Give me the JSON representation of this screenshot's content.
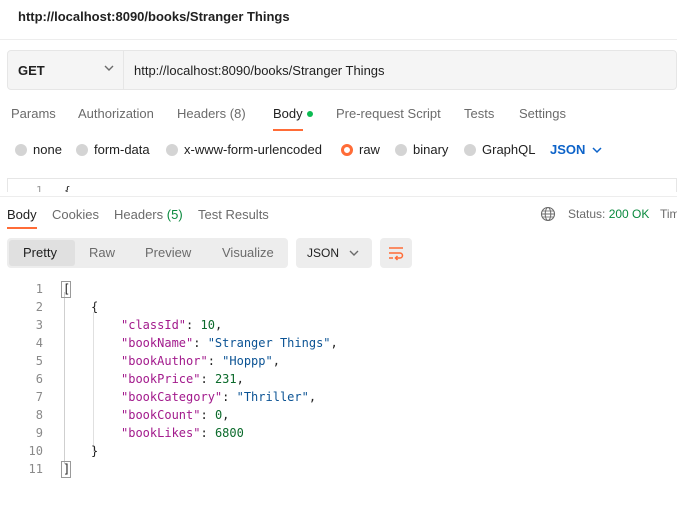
{
  "window": {
    "title": "http://localhost:8090/books/Stranger Things"
  },
  "request": {
    "method": "GET",
    "url": "http://localhost:8090/books/Stranger Things"
  },
  "request_tabs": {
    "params": "Params",
    "authorization": "Authorization",
    "headers": "Headers",
    "headers_count": "(8)",
    "body": "Body",
    "prerequest": "Pre-request Script",
    "tests": "Tests",
    "settings": "Settings"
  },
  "body_types": {
    "none": "none",
    "form_data": "form-data",
    "urlencoded": "x-www-form-urlencoded",
    "raw": "raw",
    "binary": "binary",
    "graphql": "GraphQL",
    "format": "JSON",
    "selected": "raw"
  },
  "request_editor": {
    "line_number": "1",
    "code": "{"
  },
  "response_tabs": {
    "body": "Body",
    "cookies": "Cookies",
    "headers": "Headers",
    "headers_count": "(5)",
    "test_results": "Test Results"
  },
  "response_status": {
    "status_label": "Status:",
    "status_value": "200 OK",
    "time_label": "Tim"
  },
  "view_modes": {
    "pretty": "Pretty",
    "raw": "Raw",
    "preview": "Preview",
    "visualize": "Visualize",
    "active": "Pretty"
  },
  "response_format": "JSON",
  "response_body": {
    "lines": [
      {
        "n": "1",
        "text": "["
      },
      {
        "n": "2",
        "text": "{"
      },
      {
        "n": "3",
        "key": "\"classId\"",
        "value": "10",
        "vtype": "num",
        "comma": ","
      },
      {
        "n": "4",
        "key": "\"bookName\"",
        "value": "\"Stranger Things\"",
        "vtype": "str",
        "comma": ","
      },
      {
        "n": "5",
        "key": "\"bookAuthor\"",
        "value": "\"Hoppp\"",
        "vtype": "str",
        "comma": ","
      },
      {
        "n": "6",
        "key": "\"bookPrice\"",
        "value": "231",
        "vtype": "num",
        "comma": ","
      },
      {
        "n": "7",
        "key": "\"bookCategory\"",
        "value": "\"Thriller\"",
        "vtype": "str",
        "comma": ","
      },
      {
        "n": "8",
        "key": "\"bookCount\"",
        "value": "0",
        "vtype": "num",
        "comma": ","
      },
      {
        "n": "9",
        "key": "\"bookLikes\"",
        "value": "6800",
        "vtype": "num",
        "comma": ""
      },
      {
        "n": "10",
        "text": "}"
      },
      {
        "n": "11",
        "text": "]"
      }
    ]
  },
  "colors": {
    "accent": "#ff6c37",
    "active_dot": "#0cbb52",
    "link_blue": "#0d63c9",
    "status_ok": "#0a8a3e"
  }
}
